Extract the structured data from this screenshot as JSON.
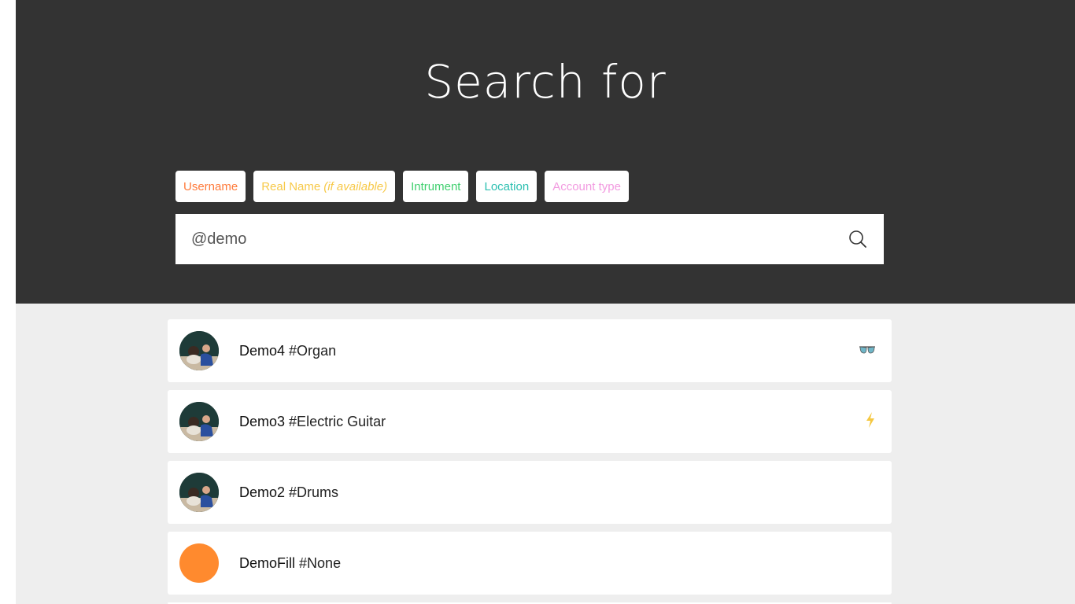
{
  "header": {
    "title": "Search for"
  },
  "filters": [
    {
      "label": "Username",
      "extra": "",
      "color": "#ff7a3a"
    },
    {
      "label": "Real Name",
      "extra": "(if available)",
      "color": "#f7c948"
    },
    {
      "label": "Intrument",
      "extra": "",
      "color": "#3fcf6e"
    },
    {
      "label": "Location",
      "extra": "",
      "color": "#2bbfb0"
    },
    {
      "label": "Account type",
      "extra": "",
      "color": "#f29ae0"
    }
  ],
  "search": {
    "value": "@demo",
    "icon": "search-icon"
  },
  "results": [
    {
      "name": "Demo4",
      "tag": "#Organ",
      "icon": "sunglasses-icon",
      "avatar": "photo"
    },
    {
      "name": "Demo3",
      "tag": "#Electric Guitar",
      "icon": "lightning-icon",
      "avatar": "photo"
    },
    {
      "name": "Demo2",
      "tag": "#Drums",
      "icon": "",
      "avatar": "photo"
    },
    {
      "name": "DemoFill",
      "tag": "#None",
      "icon": "",
      "avatar": "fill"
    }
  ],
  "colors": {
    "hero_bg": "#333333",
    "results_bg": "#eeeeee",
    "fill_avatar": "#ff8a2e",
    "lightning": "#f5c842"
  }
}
